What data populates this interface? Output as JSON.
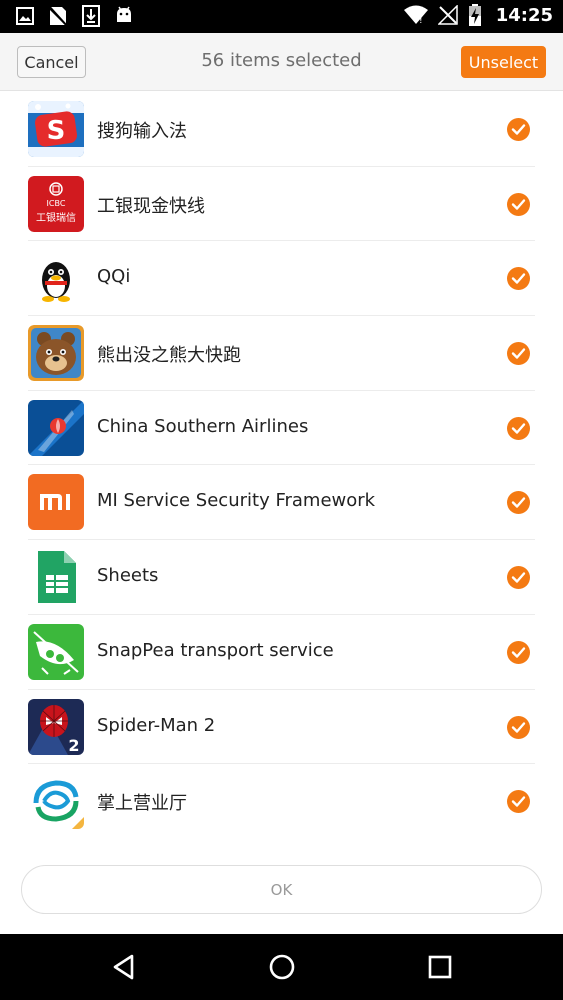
{
  "status_bar": {
    "time": "14:25",
    "left_icons": [
      "image-icon",
      "sim-disabled-icon",
      "download-icon",
      "android-icon"
    ],
    "right_icons": [
      "wifi-icon",
      "no-signal-icon",
      "battery-charging-icon"
    ]
  },
  "header": {
    "cancel_label": "Cancel",
    "title": "56 items selected",
    "unselect_label": "Unselect",
    "accent_color": "#f47a13"
  },
  "apps": [
    {
      "label": "搜狗输入法",
      "icon": "sogou-input-icon",
      "checked": true
    },
    {
      "label": "工银现金快线",
      "icon": "icbc-icon",
      "checked": true
    },
    {
      "label": "QQi",
      "icon": "qq-penguin-icon",
      "checked": true
    },
    {
      "label": "熊出没之熊大快跑",
      "icon": "bear-game-icon",
      "checked": true
    },
    {
      "label": "China Southern Airlines",
      "icon": "china-southern-icon",
      "checked": true
    },
    {
      "label": "MI Service Security Framework",
      "icon": "mi-icon",
      "checked": true
    },
    {
      "label": "Sheets",
      "icon": "sheets-icon",
      "checked": true
    },
    {
      "label": "SnapPea transport service",
      "icon": "snappea-icon",
      "checked": true
    },
    {
      "label": "Spider-Man 2",
      "icon": "spiderman-icon",
      "checked": true
    },
    {
      "label": "掌上营业厅",
      "icon": "china-mobile-icon",
      "checked": true
    }
  ],
  "ok_label": "OK",
  "nav": {
    "icons": [
      "back-icon",
      "home-icon",
      "recents-icon"
    ]
  }
}
